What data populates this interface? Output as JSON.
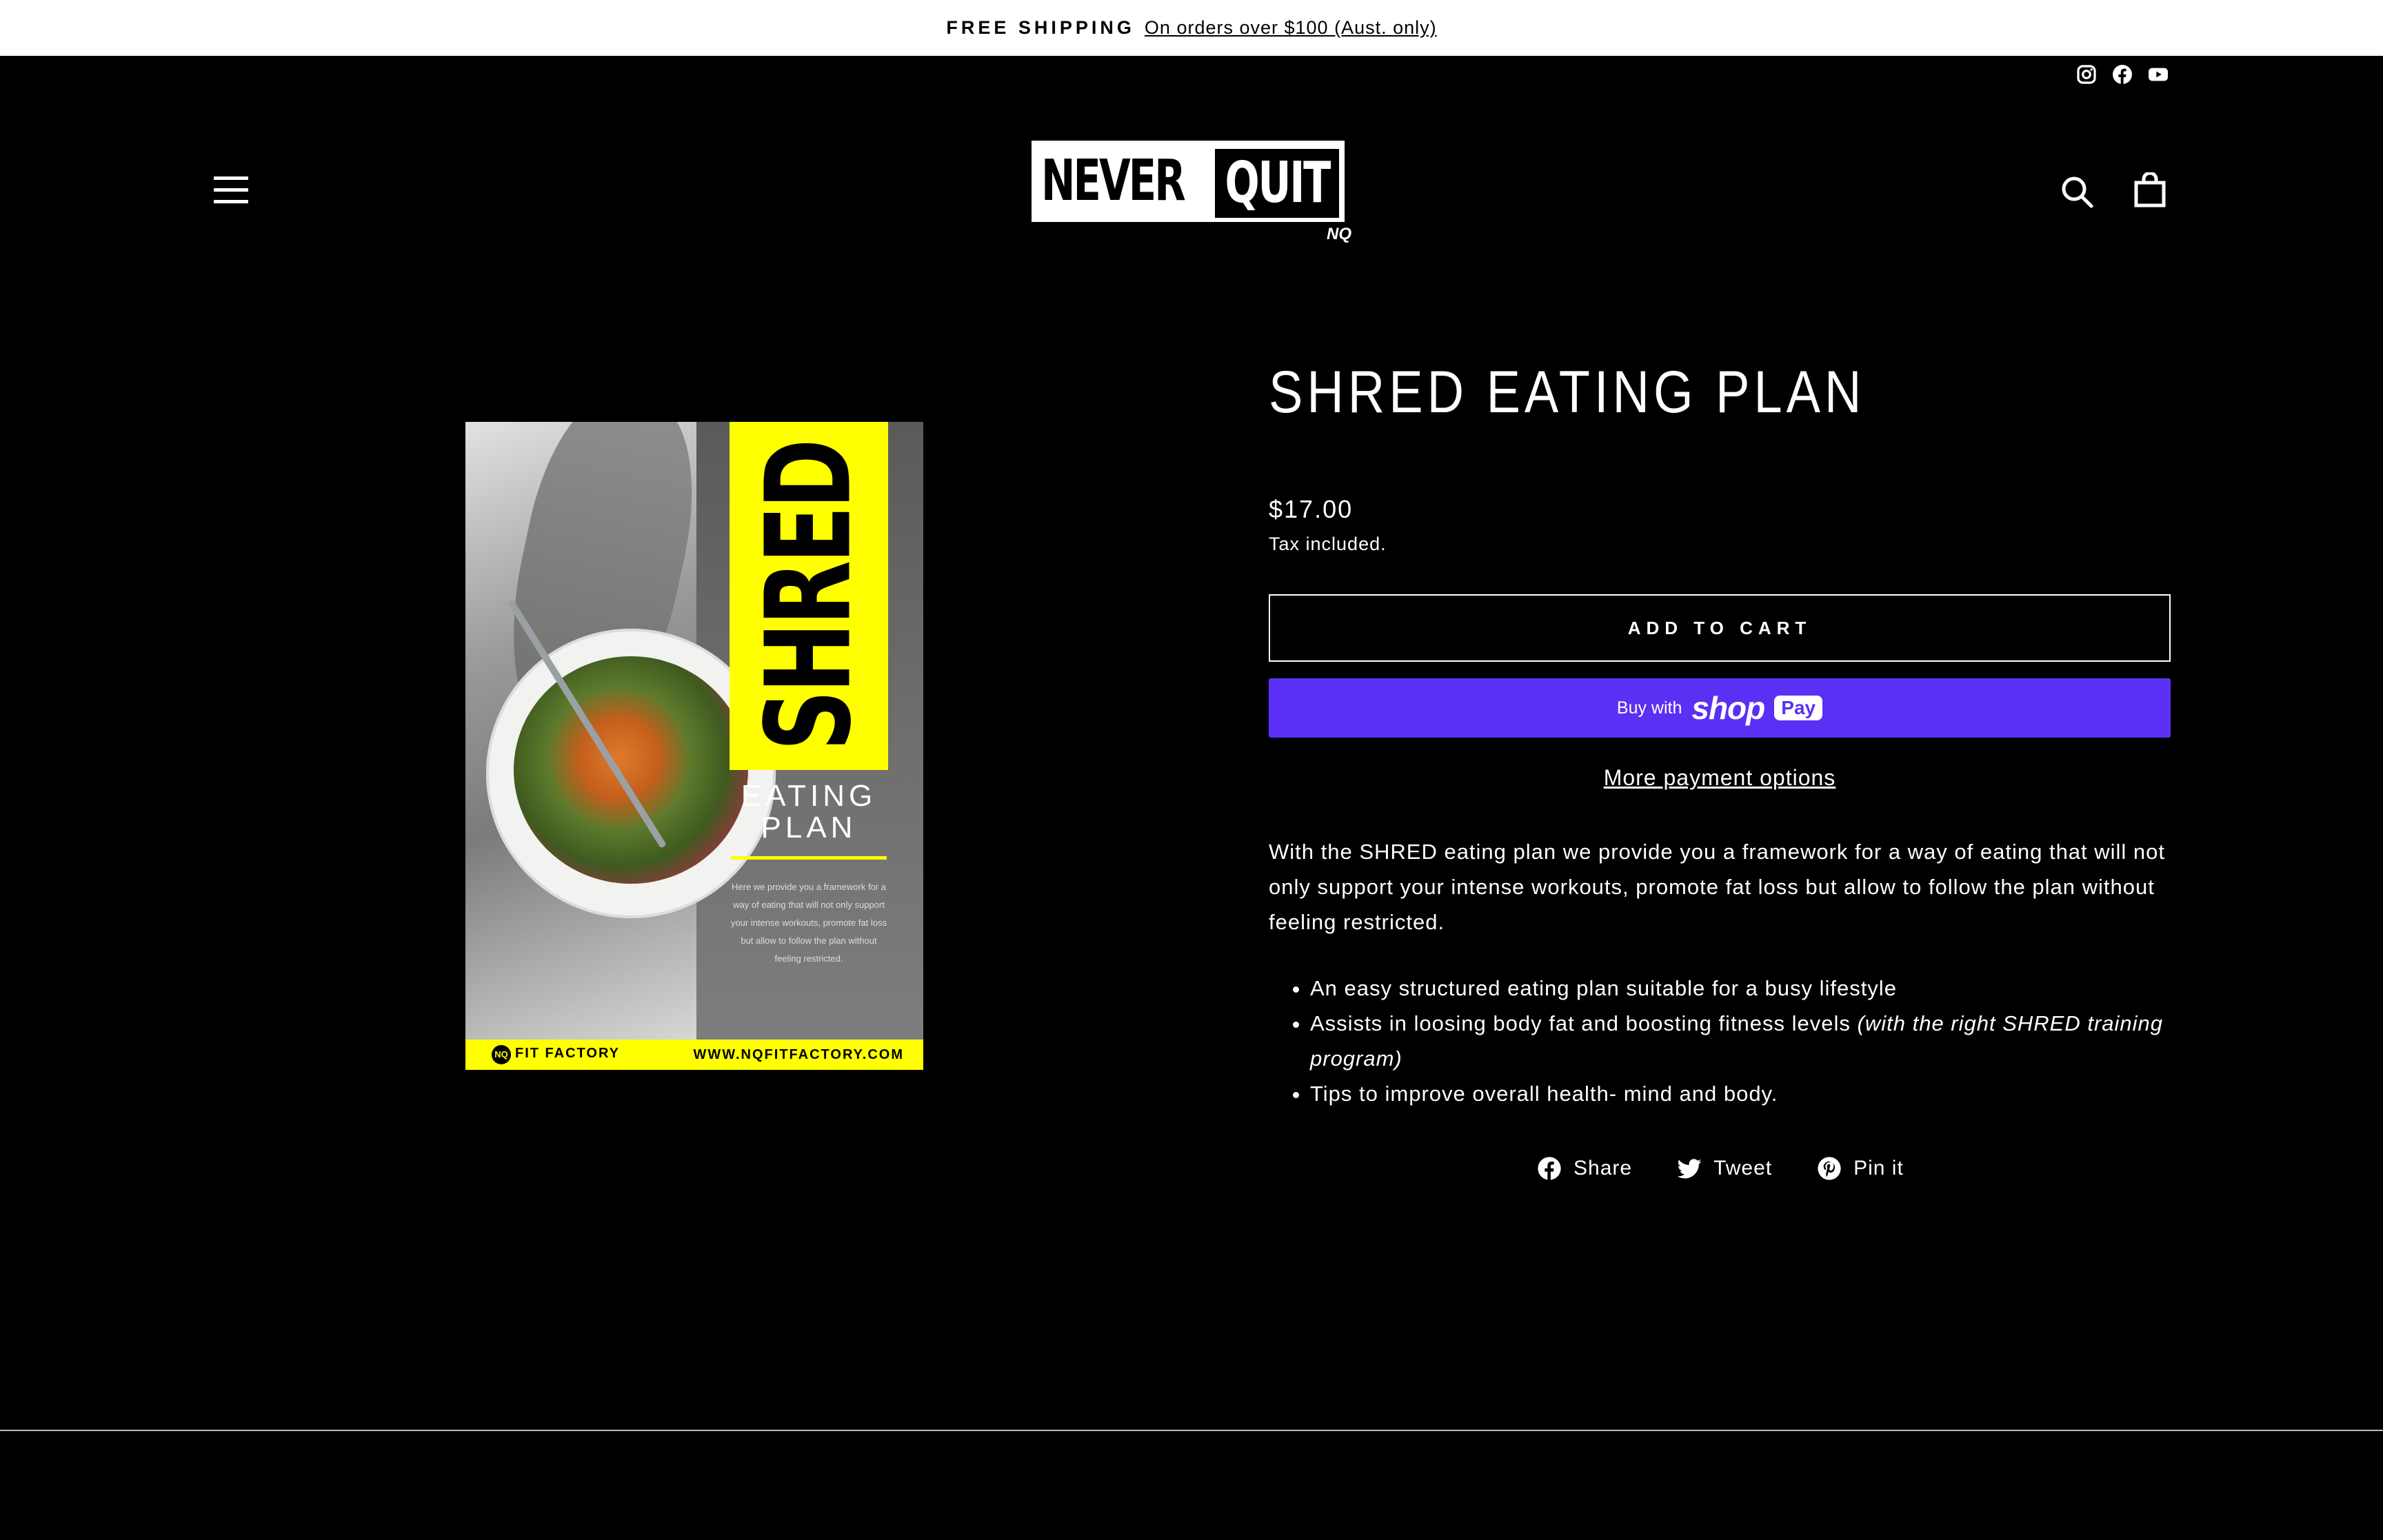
{
  "announcement": {
    "label": "FREE SHIPPING",
    "link_text": "On orders over $100 (Aust. only)"
  },
  "header": {
    "social_icons": [
      "instagram-icon",
      "facebook-icon",
      "youtube-icon"
    ],
    "logo": {
      "word1": "NEVER",
      "word2": "QUIT",
      "mark": "NQ"
    },
    "icons": [
      "menu-icon",
      "search-icon",
      "cart-icon"
    ]
  },
  "product": {
    "image": {
      "cover_title": "SHRED",
      "cover_line1": "EATING",
      "cover_line2": "PLAN",
      "cover_text": "Here we provide you a framework for a way of eating that will not only support your intense workouts, promote fat loss but allow to follow the plan without feeling restricted.",
      "footer_brand": "FIT FACTORY",
      "footer_brand_mark": "NQ",
      "footer_url": "WWW.NQFITFACTORY.COM"
    },
    "title": "SHRED EATING PLAN",
    "price": "$17.00",
    "tax_note": "Tax included.",
    "add_to_cart": "ADD TO CART",
    "shop_pay": {
      "buy_with": "Buy with",
      "shop": "shop",
      "pay": "Pay"
    },
    "more_payment": "More payment options",
    "description": "With the SHRED eating plan we provide you a framework for a way of eating that will not only support your intense workouts, promote fat loss but allow to follow the plan without feeling restricted.",
    "bullets": [
      {
        "text": "An easy structured eating plan suitable for a busy lifestyle",
        "italic": ""
      },
      {
        "text": "Assists in loosing body fat and boosting fitness levels ",
        "italic": "(with the right SHRED training program)"
      },
      {
        "text": "Tips to improve overall health- mind and body.",
        "italic": ""
      }
    ],
    "share": [
      {
        "label": "Share",
        "icon": "facebook-icon"
      },
      {
        "label": "Tweet",
        "icon": "twitter-icon"
      },
      {
        "label": "Pin it",
        "icon": "pinterest-icon"
      }
    ]
  },
  "colors": {
    "background": "#000000",
    "announcement_bg": "#ffffff",
    "shop_pay": "#5a31f4",
    "cover_accent": "#ffff00"
  }
}
